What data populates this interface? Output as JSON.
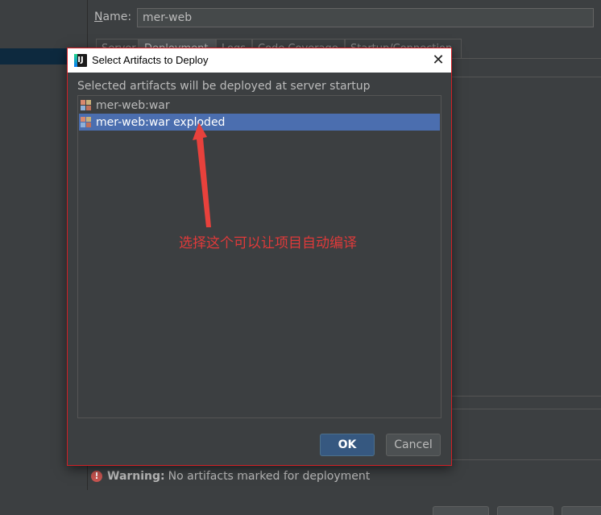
{
  "config": {
    "name_label_underlined": "N",
    "name_label_rest": "ame:",
    "name_value": "mer-web",
    "tabs": [
      {
        "label": "Server"
      },
      {
        "label": "Deployment"
      },
      {
        "label": "Logs"
      },
      {
        "label": "Code Coverage"
      },
      {
        "label": "Startup/Connection"
      }
    ],
    "active_tab": "Deployment"
  },
  "warning": {
    "bold": "Warning:",
    "text": "No artifacts marked for deployment",
    "icon": "!"
  },
  "dialog": {
    "title": "Select Artifacts to Deploy",
    "logo": "IJ",
    "close": "✕",
    "description": "Selected artifacts will be deployed at server startup",
    "items": [
      {
        "label": "mer-web:war",
        "selected": false,
        "icon": "artifact-icon"
      },
      {
        "label": "mer-web:war exploded",
        "selected": true,
        "icon": "artifact-icon"
      }
    ],
    "ok_label": "OK",
    "cancel_label": "Cancel"
  },
  "annotation": {
    "text": "选择这个可以让项目自动编译",
    "color": "#e03a3a"
  },
  "colors": {
    "background": "#3c3f41",
    "selection": "#4b6eaf",
    "primary_button": "#365880",
    "dialog_border": "#d21f25"
  }
}
